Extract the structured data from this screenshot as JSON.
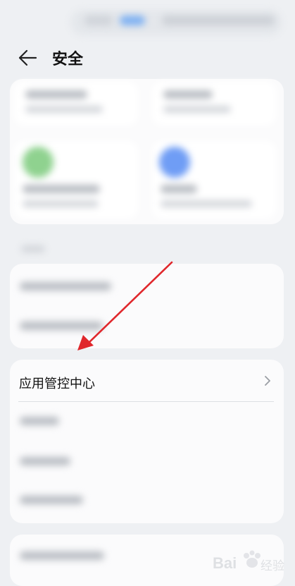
{
  "header": {
    "title": "安全"
  },
  "menu": {
    "app_center_label": "应用管控中心"
  },
  "icons": {
    "back": "arrow-left-icon",
    "chevron": "chevron-right-icon",
    "annotation": "red-arrow-annotation"
  },
  "colors": {
    "background": "#eef0f3",
    "card": "#ffffff",
    "annotation_red": "#e0272c",
    "green_dot": "#8fd28f",
    "blue_dot": "#6f9df5"
  },
  "watermark": {
    "text": "Bai 经验"
  }
}
